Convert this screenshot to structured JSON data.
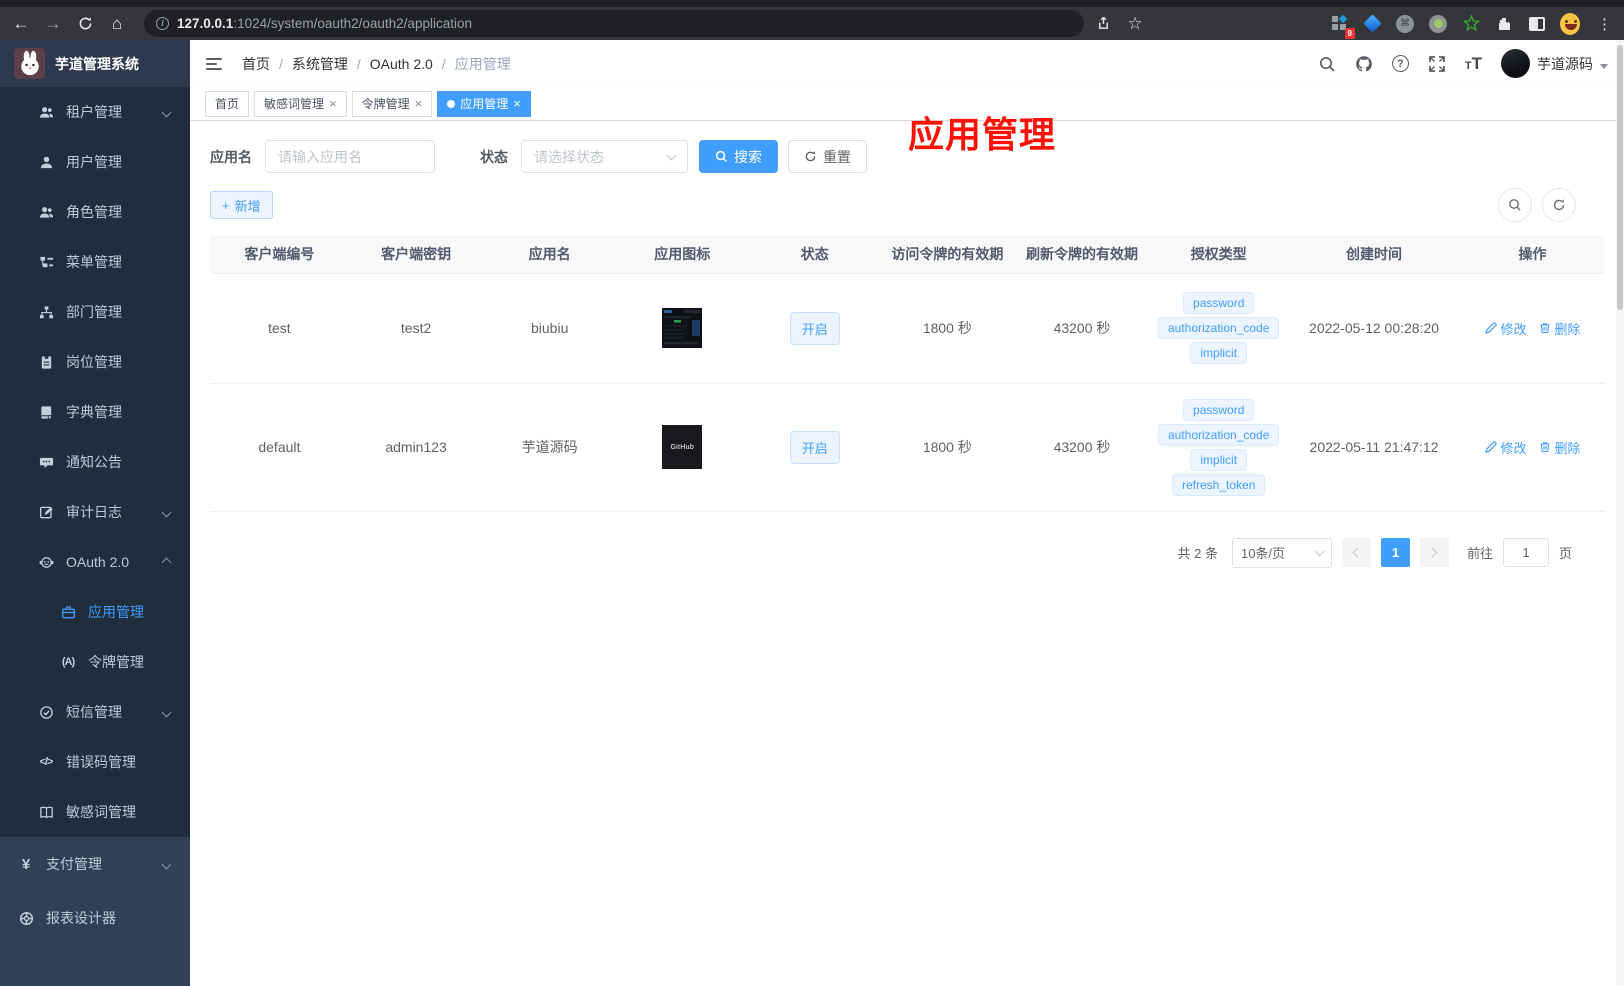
{
  "browser": {
    "url_host": "127.0.0.1",
    "url_path": ":1024/system/oauth2/oauth2/application",
    "extension_badge": "9"
  },
  "icons": {
    "back_arrow": "←",
    "forward_arrow": "→",
    "home": "⌂",
    "star": "☆",
    "kebab": "⋮",
    "info": "i",
    "close": "×",
    "slash": "/",
    "question": "?",
    "plus": "+",
    "token_glyph": "(A)",
    "code_glyph": "</>",
    "yen_glyph": "¥",
    "font_small": "T",
    "font_big": "T"
  },
  "sidebar": {
    "logo_title": "芋道管理系统",
    "menu": [
      {
        "label": "租户管理"
      },
      {
        "label": "用户管理"
      },
      {
        "label": "角色管理"
      },
      {
        "label": "菜单管理"
      },
      {
        "label": "部门管理"
      },
      {
        "label": "岗位管理"
      },
      {
        "label": "字典管理"
      },
      {
        "label": "通知公告"
      },
      {
        "label": "审计日志"
      },
      {
        "label": "OAuth 2.0"
      },
      {
        "label": "应用管理",
        "active": true
      },
      {
        "label": "令牌管理"
      },
      {
        "label": "短信管理"
      },
      {
        "label": "错误码管理"
      },
      {
        "label": "敏感词管理"
      }
    ],
    "bottom_menu": [
      {
        "label": "支付管理"
      },
      {
        "label": "报表设计器"
      }
    ]
  },
  "navbar": {
    "breadcrumb": [
      "首页",
      "系统管理",
      "OAuth 2.0",
      "应用管理"
    ],
    "username": "芋道源码"
  },
  "annotation": "应用管理",
  "tabs": [
    {
      "label": "首页"
    },
    {
      "label": "敏感词管理"
    },
    {
      "label": "令牌管理"
    },
    {
      "label": "应用管理"
    }
  ],
  "filters": {
    "name_label": "应用名",
    "name_placeholder": "请输入应用名",
    "status_label": "状态",
    "status_placeholder": "请选择状态",
    "search_label": "搜索",
    "reset_label": "重置",
    "add_label": "新增"
  },
  "table": {
    "headers": [
      "客户端编号",
      "客户端密钥",
      "应用名",
      "应用图标",
      "状态",
      "访问令牌的有效期",
      "刷新令牌的有效期",
      "授权类型",
      "创建时间",
      "操作"
    ],
    "edit_label": "修改",
    "delete_label": "删除",
    "rows": [
      {
        "client_id": "test",
        "client_secret": "test2",
        "name": "biubiu",
        "icon_text": "",
        "status": "开启",
        "access_validity": "1800 秒",
        "refresh_validity": "43200 秒",
        "grants": [
          "password",
          "authorization_code",
          "implicit"
        ],
        "created_at": "2022-05-12 00:28:20"
      },
      {
        "client_id": "default",
        "client_secret": "admin123",
        "name": "芋道源码",
        "icon_text": "GitHub",
        "status": "开启",
        "access_validity": "1800 秒",
        "refresh_validity": "43200 秒",
        "grants": [
          "password",
          "authorization_code",
          "implicit",
          "refresh_token"
        ],
        "created_at": "2022-05-11 21:47:12"
      }
    ]
  },
  "pagination": {
    "total": "共 2 条",
    "page_size": "10条/页",
    "current_page": "1",
    "goto_label": "前往",
    "goto_value": "1",
    "page_unit": "页"
  },
  "colors": {
    "accent": "#409eff",
    "sidebar_bg": "#304156",
    "submenu_bg": "#1f2d3d",
    "annotation_red": "#fd1205",
    "tag_bg": "#ecf5ff",
    "active_tab_bg": "#409eff"
  }
}
